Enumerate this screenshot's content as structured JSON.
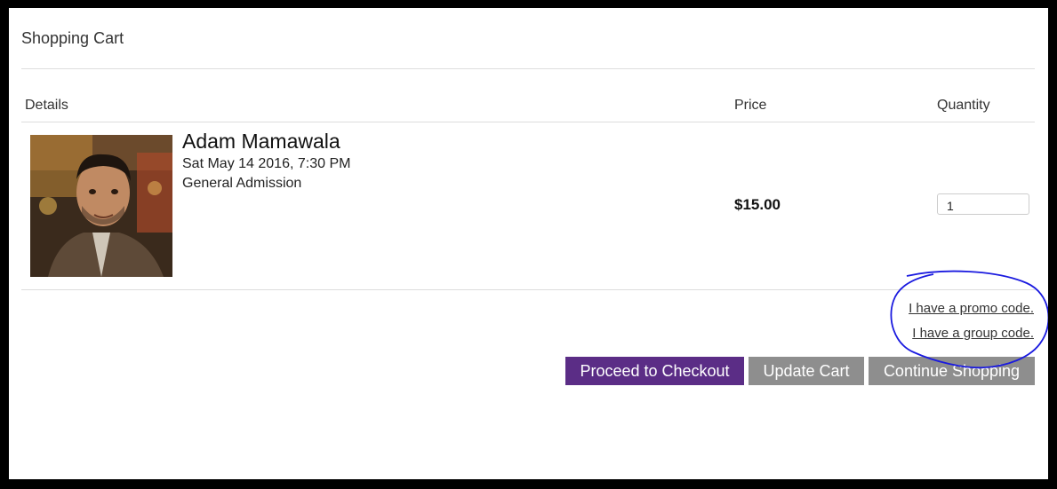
{
  "cart": {
    "title": "Shopping Cart",
    "columns": {
      "details": "Details",
      "price": "Price",
      "quantity": "Quantity"
    },
    "items": [
      {
        "name": "Adam Mamawala",
        "date": "Sat May 14 2016, 7:30 PM",
        "ticket_type": "General Admission",
        "price": "$15.00",
        "quantity": "1"
      }
    ],
    "links": {
      "promo": "I have a promo code.",
      "group": "I have a group code."
    },
    "buttons": {
      "checkout": "Proceed to Checkout",
      "update": "Update Cart",
      "continue": "Continue Shopping"
    }
  },
  "colors": {
    "checkout_button": "#5b2d86",
    "secondary_button": "#8e8e8e",
    "annotation_circle": "#1a1adf"
  }
}
